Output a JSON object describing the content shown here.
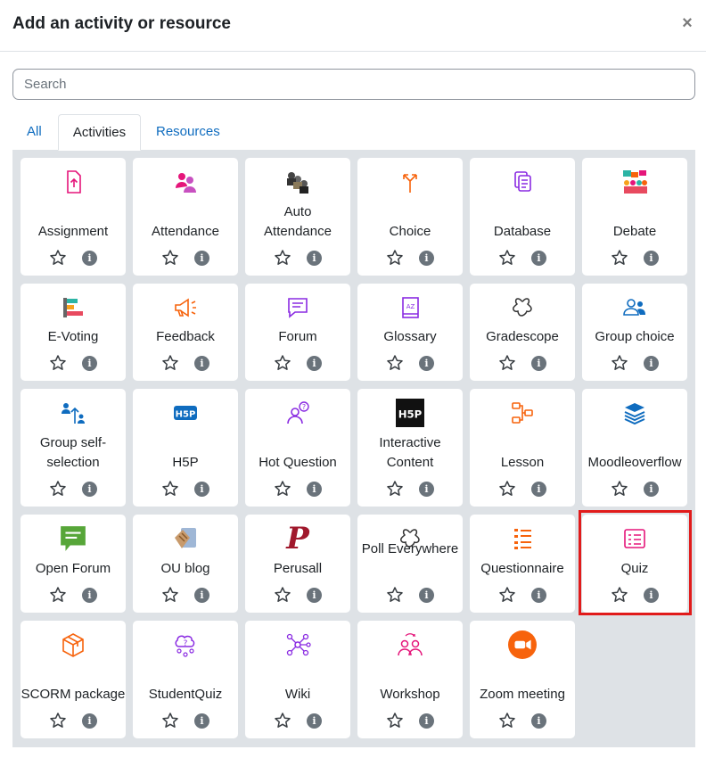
{
  "modal": {
    "title": "Add an activity or resource",
    "close_label": "×",
    "search": {
      "placeholder": "Search",
      "value": ""
    }
  },
  "tabs": [
    {
      "label": "All",
      "active": false
    },
    {
      "label": "Activities",
      "active": true
    },
    {
      "label": "Resources",
      "active": false
    }
  ],
  "items": [
    {
      "label": "Assignment",
      "icon": "assignment-icon"
    },
    {
      "label": "Attendance",
      "icon": "attendance-icon"
    },
    {
      "label": "Auto Attendance",
      "icon": "auto-attendance-icon"
    },
    {
      "label": "Choice",
      "icon": "choice-icon"
    },
    {
      "label": "Database",
      "icon": "database-icon"
    },
    {
      "label": "Debate",
      "icon": "debate-icon"
    },
    {
      "label": "E-Voting",
      "icon": "evoting-icon"
    },
    {
      "label": "Feedback",
      "icon": "feedback-icon"
    },
    {
      "label": "Forum",
      "icon": "forum-icon"
    },
    {
      "label": "Glossary",
      "icon": "glossary-icon"
    },
    {
      "label": "Gradescope",
      "icon": "gradescope-icon"
    },
    {
      "label": "Group choice",
      "icon": "group-choice-icon"
    },
    {
      "label": "Group self-selection",
      "icon": "group-self-selection-icon"
    },
    {
      "label": "H5P",
      "icon": "h5p-icon"
    },
    {
      "label": "Hot Question",
      "icon": "hot-question-icon"
    },
    {
      "label": "Interactive Content",
      "icon": "interactive-content-icon"
    },
    {
      "label": "Lesson",
      "icon": "lesson-icon"
    },
    {
      "label": "Moodleoverflow",
      "icon": "moodleoverflow-icon"
    },
    {
      "label": "Open Forum",
      "icon": "open-forum-icon"
    },
    {
      "label": "OU blog",
      "icon": "ou-blog-icon"
    },
    {
      "label": "Perusall",
      "icon": "perusall-icon",
      "glyph": "P"
    },
    {
      "label": "Poll Everywhere",
      "icon": "poll-everywhere-icon"
    },
    {
      "label": "Questionnaire",
      "icon": "questionnaire-icon"
    },
    {
      "label": "Quiz",
      "icon": "quiz-icon"
    },
    {
      "label": "SCORM package",
      "icon": "scorm-package-icon"
    },
    {
      "label": "StudentQuiz",
      "icon": "studentquiz-icon"
    },
    {
      "label": "Wiki",
      "icon": "wiki-icon"
    },
    {
      "label": "Workshop",
      "icon": "workshop-icon"
    },
    {
      "label": "Zoom meeting",
      "icon": "zoom-meeting-icon"
    }
  ],
  "colors": {
    "pink": "#e5157a",
    "purple": "#8a2be2",
    "orange": "#f7630c",
    "blue": "#0f6cbf",
    "highlight": "#e11b1b"
  }
}
